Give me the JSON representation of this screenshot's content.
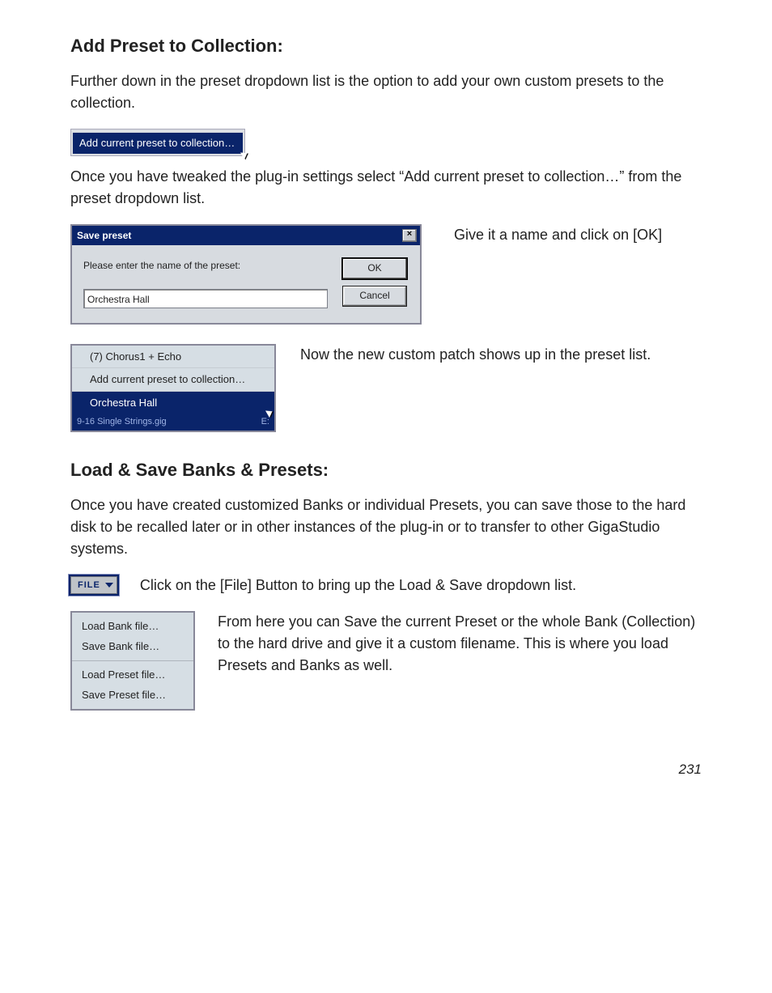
{
  "headings": {
    "add_preset": "Add Preset to Collection:",
    "load_save": "Load & Save Banks & Presets:"
  },
  "paragraphs": {
    "intro1": "Further down in the preset dropdown list is the option to add your own custom presets to the collection.",
    "after_menu": "Once you have tweaked the plug-in settings select “Add current preset to collection…” from the preset dropdown list.",
    "give_name": "Give it a name and click on [OK]",
    "now_shows": "Now the new custom patch shows up in the preset list.",
    "load_save_body": "Once you have created customized Banks or individual Presets, you can save those to the hard disk to be recalled later or in other instances of the plug-in or to transfer to other GigaStudio systems.",
    "file_click": "Click on the [File] Button to bring up the Load & Save dropdown list.",
    "from_here": "From here you can Save the current Preset or the whole Bank (Collection) to the hard drive and give it a custom filename.  This is where you load Presets and Banks as well."
  },
  "menu_item": "Add current preset to collection…",
  "dialog": {
    "title": "Save preset",
    "prompt": "Please enter the name of the preset:",
    "ok": "OK",
    "cancel": "Cancel",
    "value": "Orchestra Hall",
    "close": "×"
  },
  "preset_list": {
    "item1": "(7) Chorus1 + Echo",
    "item2": "Add current preset to collection…",
    "item3_selected": "Orchestra Hall",
    "footer_left": "9-16 Single Strings.gig",
    "footer_right": "E:"
  },
  "file_button": "FILE",
  "ls_menu": {
    "load_bank": "Load Bank file…",
    "save_bank": "Save Bank file…",
    "load_preset": "Load Preset file…",
    "save_preset": "Save Preset file…"
  },
  "page_number": "231"
}
